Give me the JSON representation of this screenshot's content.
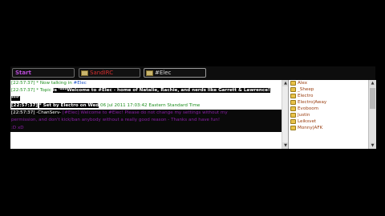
{
  "tabs": [
    {
      "label": "Start",
      "active": false
    },
    {
      "label": "SandIRC",
      "active": false
    },
    {
      "label": "#Elec",
      "active": true
    }
  ],
  "chat": {
    "lines": [
      {
        "ts": "[22:57:37]",
        "pre": "* Now talking in ",
        "hl": "#Elec",
        "post": ""
      },
      {
        "ts": "[22:57:37]",
        "pre": "* Topic ",
        "hl": "is '***Welcome to #Elec - home of Natalie, Rachie, and nerds like Garrett & Lawrence!",
        "post": ""
      },
      {
        "ts": "",
        "pre": "",
        "hl": "***'",
        "post": ""
      },
      {
        "ts": "[22:57:37]",
        "pre": "",
        "hl": "* Set by Electro on Wed",
        "post": " 06 Jul 2011 17:03:42 Eastern Standard Time"
      },
      {
        "ts": "[22:57:37]",
        "pre": "",
        "hl": "-ChanServ-",
        "post": " [#Elec] Welcome to #Elec! Please do not change my settings without my"
      },
      {
        "ts": "",
        "pre": "",
        "hl": "",
        "post": "permission, and don't kick/ban anybody without a really good reason - Thanks and have fun!"
      },
      {
        "ts": "",
        "pre": "",
        "hl": ":D xD",
        "post": ""
      }
    ]
  },
  "users": [
    {
      "name": "Alex"
    },
    {
      "name": "_Sheep"
    },
    {
      "name": "Electro"
    },
    {
      "name": "Electro|Away"
    },
    {
      "name": "Evoboom"
    },
    {
      "name": "Justin"
    },
    {
      "name": "Leiksvet"
    },
    {
      "name": "Monny|AFK"
    }
  ],
  "colors": {
    "timestamp": "#1f8f1f",
    "start_tab": "#b84bd6",
    "server_tab": "#d22e2e",
    "user_text": "#9a3d0f"
  }
}
